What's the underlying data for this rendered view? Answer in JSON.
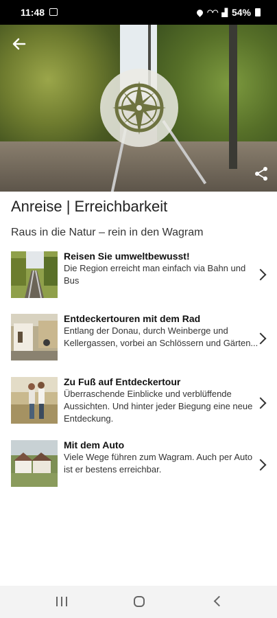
{
  "status_bar": {
    "time": "11:48",
    "battery": "54%",
    "icons": [
      "gallery-icon",
      "location-icon",
      "wifi-icon",
      "signal-icon",
      "battery-icon"
    ]
  },
  "header": {
    "back_icon": "arrow-left-icon",
    "share_icon": "share-icon",
    "logo": "compass-icon"
  },
  "page": {
    "title": "Anreise | Erreichbarkeit",
    "subtitle": "Raus in die Natur – rein in den Wagram"
  },
  "items": [
    {
      "title": "Reisen Sie umweltbewusst!",
      "desc": "Die Region erreicht man einfach via Bahn und Bus"
    },
    {
      "title": "Entdeckertouren mit dem Rad",
      "desc": "Entlang der Donau, durch Weinberge und Kellergassen, vorbei an Schlössern und Gärten..."
    },
    {
      "title": "Zu Fuß auf Entdeckertour",
      "desc": "Überraschende Einblicke und verblüffende Aussichten. Und hinter jeder Biegung eine neue Entdeckung."
    },
    {
      "title": "Mit dem Auto",
      "desc": "Viele Wege führen zum Wagram. Auch per Auto ist er bestens erreichbar."
    }
  ],
  "nav": {
    "recent_icon": "recent-apps-icon",
    "home_icon": "home-icon",
    "back_icon": "back-icon"
  },
  "colors": {
    "status_bg": "#000000",
    "navbar_bg": "#f3f3f3",
    "compass_green": "#6e7340"
  }
}
